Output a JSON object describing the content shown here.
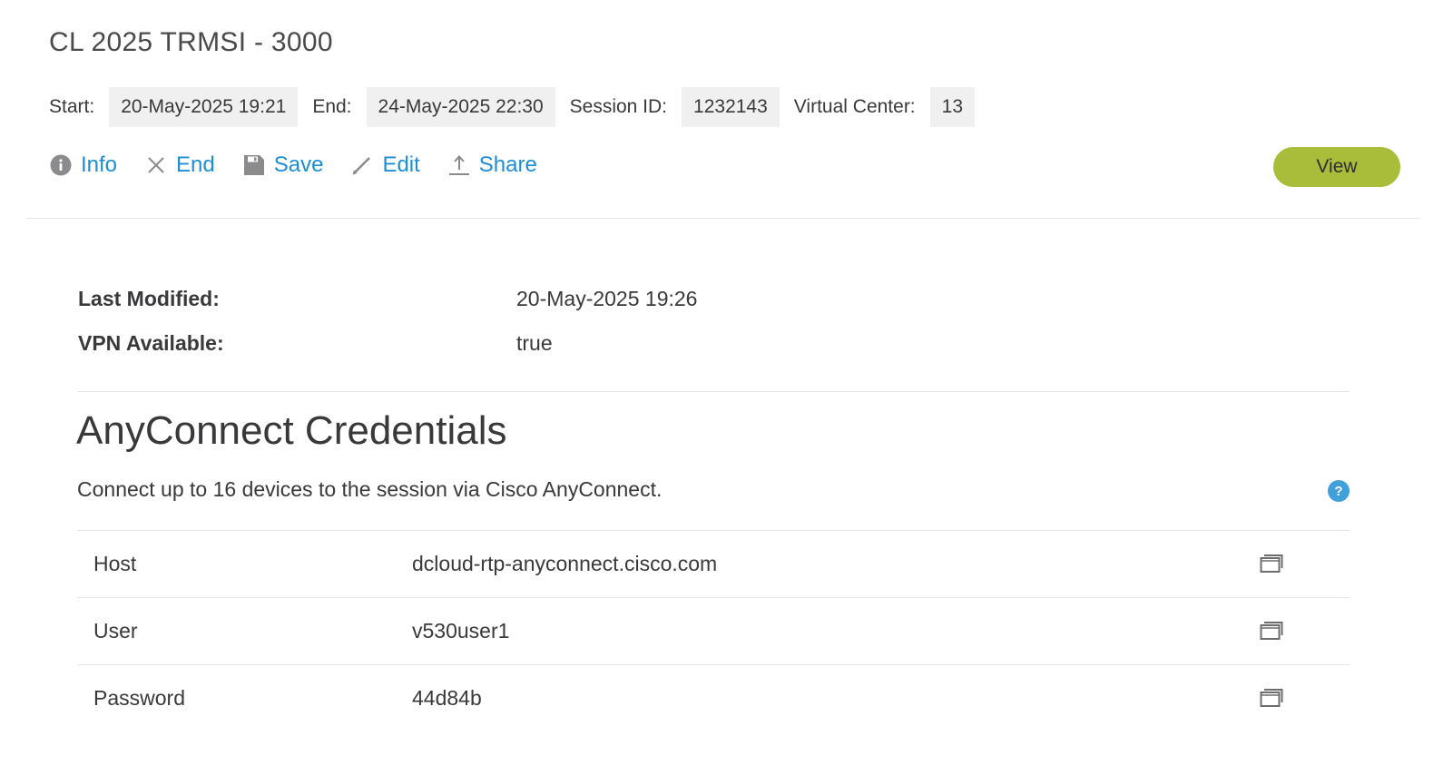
{
  "session": {
    "title": "CL 2025 TRMSI - 3000",
    "meta": [
      {
        "label": "Start:",
        "value": "20-May-2025 19:21"
      },
      {
        "label": "End:",
        "value": "24-May-2025 22:30"
      },
      {
        "label": "Session ID:",
        "value": "1232143"
      },
      {
        "label": "Virtual Center:",
        "value": "13"
      }
    ]
  },
  "actions": {
    "info": {
      "label": "Info",
      "icon": "info-icon"
    },
    "end": {
      "label": "End",
      "icon": "close-icon"
    },
    "save": {
      "label": "Save",
      "icon": "floppy-disk-icon"
    },
    "edit": {
      "label": "Edit",
      "icon": "pencil-icon"
    },
    "share": {
      "label": "Share",
      "icon": "upload-icon"
    },
    "view": {
      "label": "View"
    }
  },
  "details": {
    "last_modified": {
      "label": "Last Modified:",
      "value": "20-May-2025 19:26"
    },
    "vpn_available": {
      "label": "VPN Available:",
      "value": "true"
    }
  },
  "anyconnect": {
    "title": "AnyConnect Credentials",
    "description": "Connect up to 16 devices to the session via Cisco AnyConnect.",
    "help_icon": "question-icon",
    "rows": [
      {
        "key": "Host",
        "value": "dcloud-rtp-anyconnect.cisco.com",
        "icon": "copy-icon"
      },
      {
        "key": "User",
        "value": "v530user1",
        "icon": "copy-icon"
      },
      {
        "key": "Password",
        "value": "44d84b",
        "icon": "copy-icon"
      }
    ]
  },
  "colors": {
    "link": "#1d8ed6",
    "view_button": "#a9bd3a",
    "help_icon": "#3fa0dc",
    "meta_value_bg": "#f0f0f0"
  }
}
